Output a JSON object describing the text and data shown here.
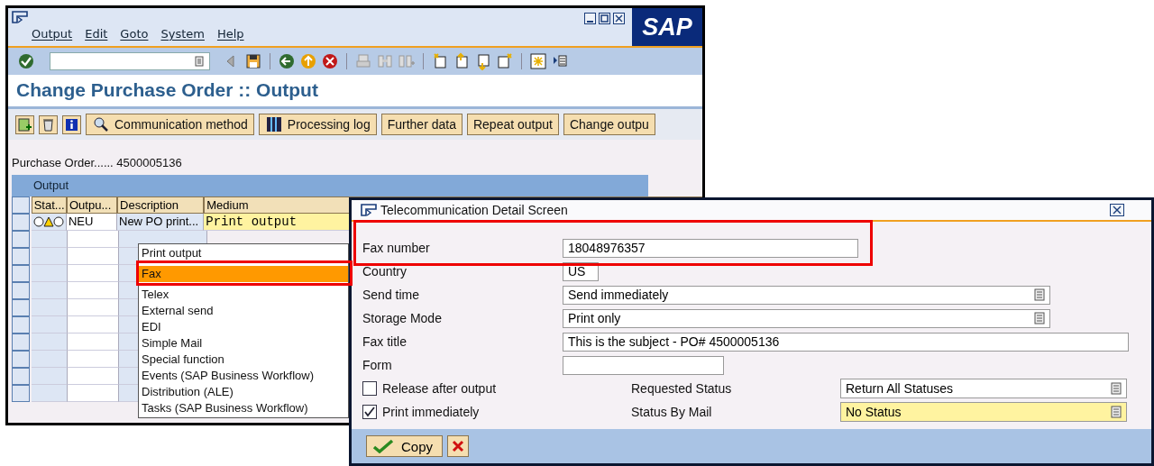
{
  "main_window": {
    "menu": [
      "Output",
      "Edit",
      "Goto",
      "System",
      "Help"
    ],
    "logo": "SAP",
    "title": "Change Purchase Order :: Output",
    "app_buttons": [
      {
        "label": "Communication method"
      },
      {
        "label": "Processing log"
      },
      {
        "label": "Further data"
      },
      {
        "label": "Repeat output"
      },
      {
        "label": "Change outpu"
      }
    ],
    "document_line": "Purchase Order...... 4500005136",
    "table": {
      "title": "Output",
      "columns": [
        "Stat...",
        "Outpu...",
        "Description",
        "Medium"
      ],
      "rows": [
        {
          "output_type": "NEU",
          "description": "New PO print...",
          "medium": "Print output"
        }
      ]
    },
    "medium_menu": [
      {
        "label": "Print output",
        "selected": false,
        "highlighted": false
      },
      {
        "label": "Fax",
        "selected": true,
        "highlighted": true
      },
      {
        "label": "Telex",
        "selected": false,
        "highlighted": false
      },
      {
        "label": "External send",
        "selected": false,
        "highlighted": false
      },
      {
        "label": "EDI",
        "selected": false,
        "highlighted": false
      },
      {
        "label": "Simple Mail",
        "selected": false,
        "highlighted": false
      },
      {
        "label": "Special function",
        "selected": false,
        "highlighted": false
      },
      {
        "label": "Events (SAP Business Workflow)",
        "selected": false,
        "highlighted": false
      },
      {
        "label": "Distribution (ALE)",
        "selected": false,
        "highlighted": false
      },
      {
        "label": "Tasks (SAP Business Workflow)",
        "selected": false,
        "highlighted": false
      }
    ]
  },
  "dialog": {
    "title": "Telecommunication Detail Screen",
    "fields": [
      {
        "label": "Fax number",
        "value": "18048976357",
        "kind": "text",
        "highlighted": true
      },
      {
        "label": "Country",
        "value": "US",
        "kind": "text",
        "highlighted": false
      },
      {
        "label": "Send time",
        "value": "Send immediately",
        "kind": "select",
        "highlighted": false
      },
      {
        "label": "Storage Mode",
        "value": "Print only",
        "kind": "select",
        "highlighted": false
      },
      {
        "label": "Fax title",
        "value": "This is the subject - PO# 4500005136",
        "kind": "text",
        "highlighted": false
      },
      {
        "label": "Form",
        "kind": "text",
        "highlighted": false
      }
    ],
    "options": [
      {
        "label": "Release after output",
        "checked": false
      },
      {
        "label": "Print immediately",
        "checked": true
      }
    ],
    "status_fields": [
      {
        "label": "Requested Status",
        "value": "Return All Statuses",
        "focused": false
      },
      {
        "label": "Status By Mail",
        "value": "No Status",
        "focused": true
      }
    ],
    "buttons": [
      {
        "kind": "confirm",
        "label": "Copy"
      },
      {
        "kind": "cancel"
      }
    ]
  }
}
